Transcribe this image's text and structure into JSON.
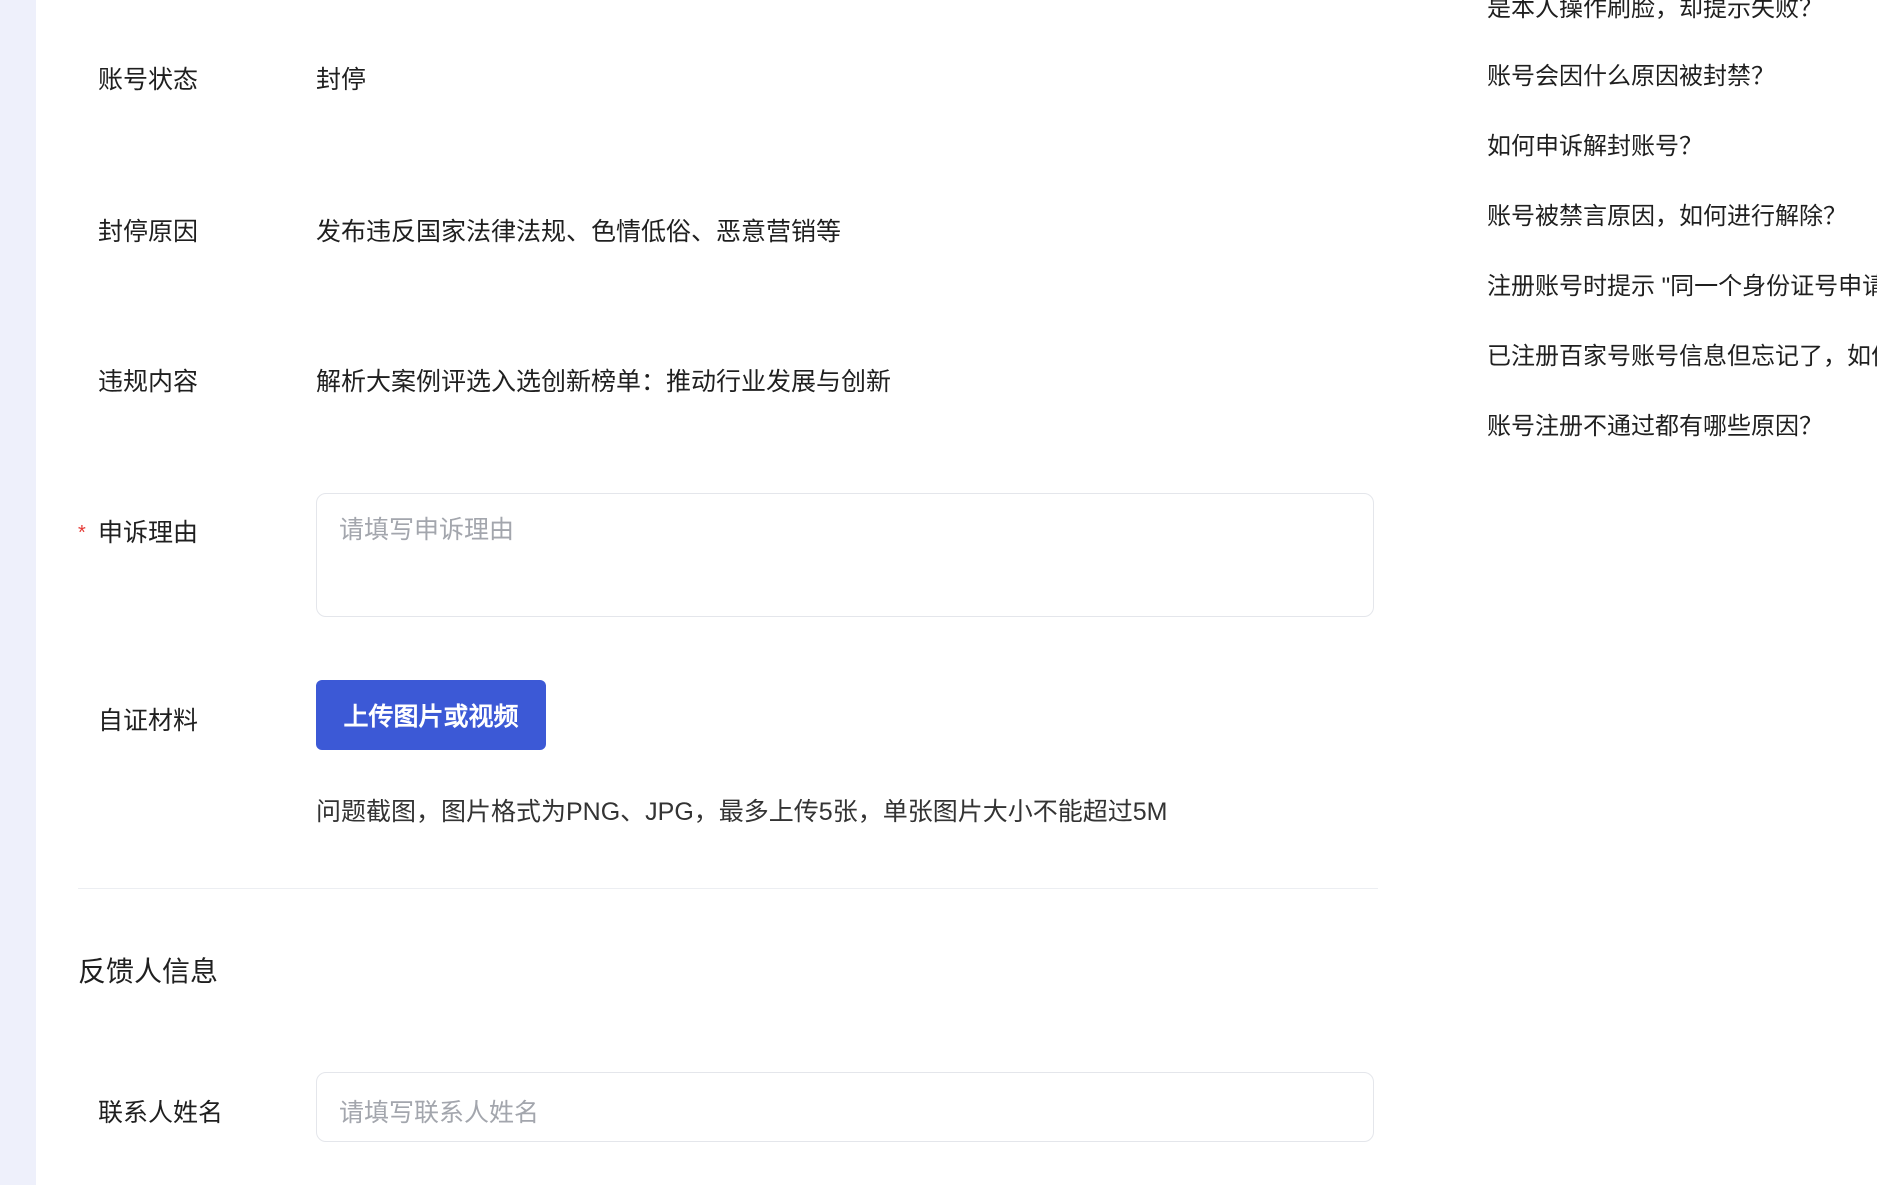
{
  "form": {
    "account_status": {
      "label": "账号状态",
      "value": "封停"
    },
    "ban_reason": {
      "label": "封停原因",
      "value": "发布违反国家法律法规、色情低俗、恶意营销等"
    },
    "violation_content": {
      "label": "违规内容",
      "value": "解析大案例评选入选创新榜单：推动行业发展与创新"
    },
    "appeal_reason": {
      "required_mark": "*",
      "label": "申诉理由",
      "placeholder": "请填写申诉理由"
    },
    "evidence": {
      "label": "自证材料",
      "upload_button": "上传图片或视频",
      "hint": "问题截图，图片格式为PNG、JPG，最多上传5张，单张图片大小不能超过5M"
    },
    "feedback_section": {
      "title": "反馈人信息"
    },
    "contact_name": {
      "label": "联系人姓名",
      "placeholder": "请填写联系人姓名"
    }
  },
  "faq": {
    "items": [
      "是本人操作刷脸，却提示失败？",
      "账号会因什么原因被封禁？",
      "如何申诉解封账号？",
      "账号被禁言原因，如何进行解除？",
      "注册账号时提示 \"同一个身份证号申请",
      "已注册百家号账号信息但忘记了，如何",
      "账号注册不通过都有哪些原因？"
    ]
  },
  "colors": {
    "primary": "#3c59d6",
    "required": "#e53935",
    "placeholder": "#a3a6ad",
    "background": "#eef0fb"
  }
}
